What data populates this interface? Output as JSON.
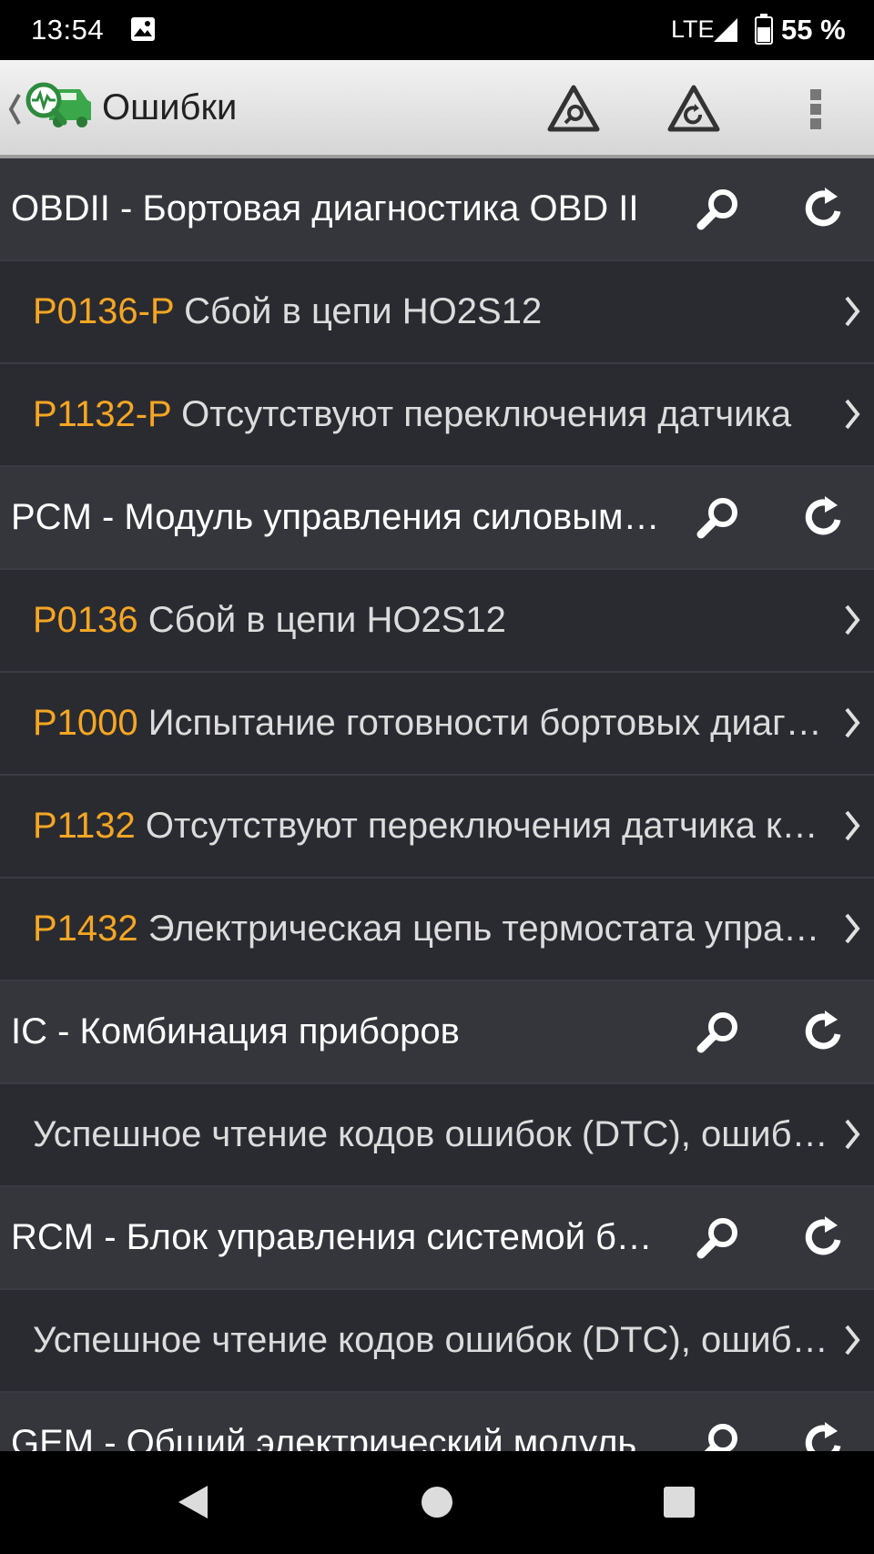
{
  "status_bar": {
    "time": "13:54",
    "network": "LTE",
    "battery": "55 %",
    "icons": [
      "gallery-icon",
      "signal-icon",
      "battery-icon"
    ]
  },
  "toolbar": {
    "title": "Ошибки",
    "icons": [
      "back-chevron-icon",
      "car-diagnostics-logo-icon",
      "warning-search-icon",
      "warning-refresh-icon",
      "overflow-menu-icon"
    ]
  },
  "list": {
    "code_color": "#f5a623",
    "modules": [
      {
        "name": "OBDII - Бортовая диагностика OBD II",
        "items": [
          {
            "code": "P0136-P",
            "desc": "Сбой в цепи HO2S12"
          },
          {
            "code": "P1132-P",
            "desc": "Отсутствуют переключения датчика"
          }
        ]
      },
      {
        "name": "PCM - Модуль управления силовым агрегатом",
        "items": [
          {
            "code": "P0136",
            "desc": "Сбой в цепи HO2S12"
          },
          {
            "code": "P1000",
            "desc": "Испытание готовности бортовых диагностических систем"
          },
          {
            "code": "P1132",
            "desc": "Отсутствуют переключения датчика кислорода"
          },
          {
            "code": "P1432",
            "desc": "Электрическая цепь термостата управления"
          }
        ]
      },
      {
        "name": "IC - Комбинация приборов",
        "items": [
          {
            "code": "",
            "desc": "Успешное чтение кодов ошибок (DTC), ошибок нет"
          }
        ]
      },
      {
        "name": "RCM - Блок управления системой безопасности",
        "items": [
          {
            "code": "",
            "desc": "Успешное чтение кодов ошибок (DTC), ошибок нет"
          }
        ]
      },
      {
        "name": "GEM - Общий электрический модуль",
        "items": []
      }
    ]
  },
  "nav_bar": {
    "icons": [
      "back-triangle-icon",
      "home-circle-icon",
      "recents-square-icon"
    ]
  }
}
